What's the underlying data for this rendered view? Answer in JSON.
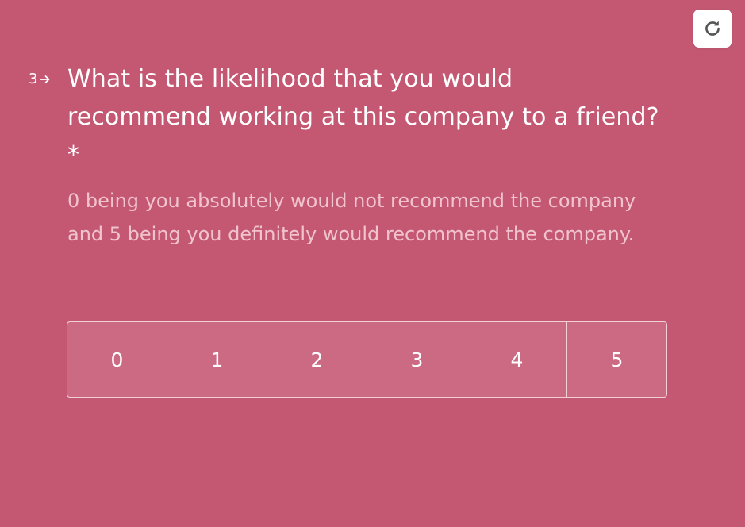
{
  "question": {
    "number": "3",
    "text": "What is the likelihood that you would recommend working at this company to a friend? *",
    "description": "0 being you absolutely would not recommend the company and 5 being you definitely would recommend the company."
  },
  "scale": {
    "options": [
      "0",
      "1",
      "2",
      "3",
      "4",
      "5"
    ]
  },
  "icons": {
    "reload": "reload-icon",
    "arrow": "arrow-right-icon"
  },
  "colors": {
    "background": "#c45873",
    "option_fill": "#cc6a83",
    "text": "#ffffff",
    "description_text": "#f0c3cd"
  }
}
